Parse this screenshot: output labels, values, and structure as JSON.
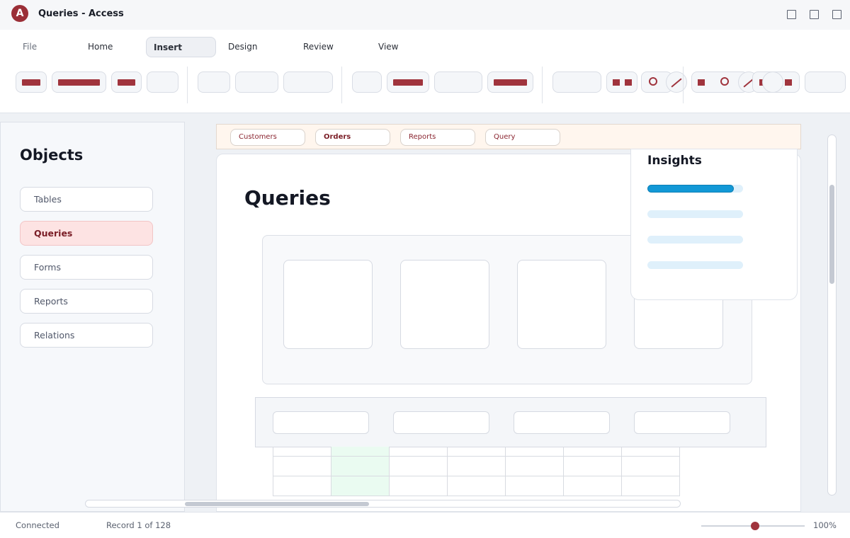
{
  "app": {
    "title": "Queries - Access",
    "icon_glyph": "A",
    "brand_color": "#9b2f37"
  },
  "ribbon": {
    "tabs": [
      {
        "label": "File"
      },
      {
        "label": "Home"
      },
      {
        "label": "Insert",
        "active": true
      },
      {
        "label": "Design"
      },
      {
        "label": "Review"
      },
      {
        "label": "View"
      }
    ]
  },
  "sidebar": {
    "title": "Objects",
    "items": [
      {
        "label": "Tables"
      },
      {
        "label": "Queries",
        "active": true
      },
      {
        "label": "Forms"
      },
      {
        "label": "Reports"
      },
      {
        "label": "Relations"
      }
    ]
  },
  "doc_tabs": [
    {
      "label": "Customers"
    },
    {
      "label": "Orders",
      "active": true
    },
    {
      "label": "Reports"
    },
    {
      "label": "Query"
    }
  ],
  "main": {
    "title": "Queries"
  },
  "insights": {
    "title": "Insights",
    "meters": [
      {
        "value": 0.9
      },
      {
        "value": 0
      },
      {
        "value": 0
      },
      {
        "value": 0
      }
    ]
  },
  "status": {
    "connection": "Connected",
    "record": "Record 1 of 128",
    "zoom": "100%"
  }
}
